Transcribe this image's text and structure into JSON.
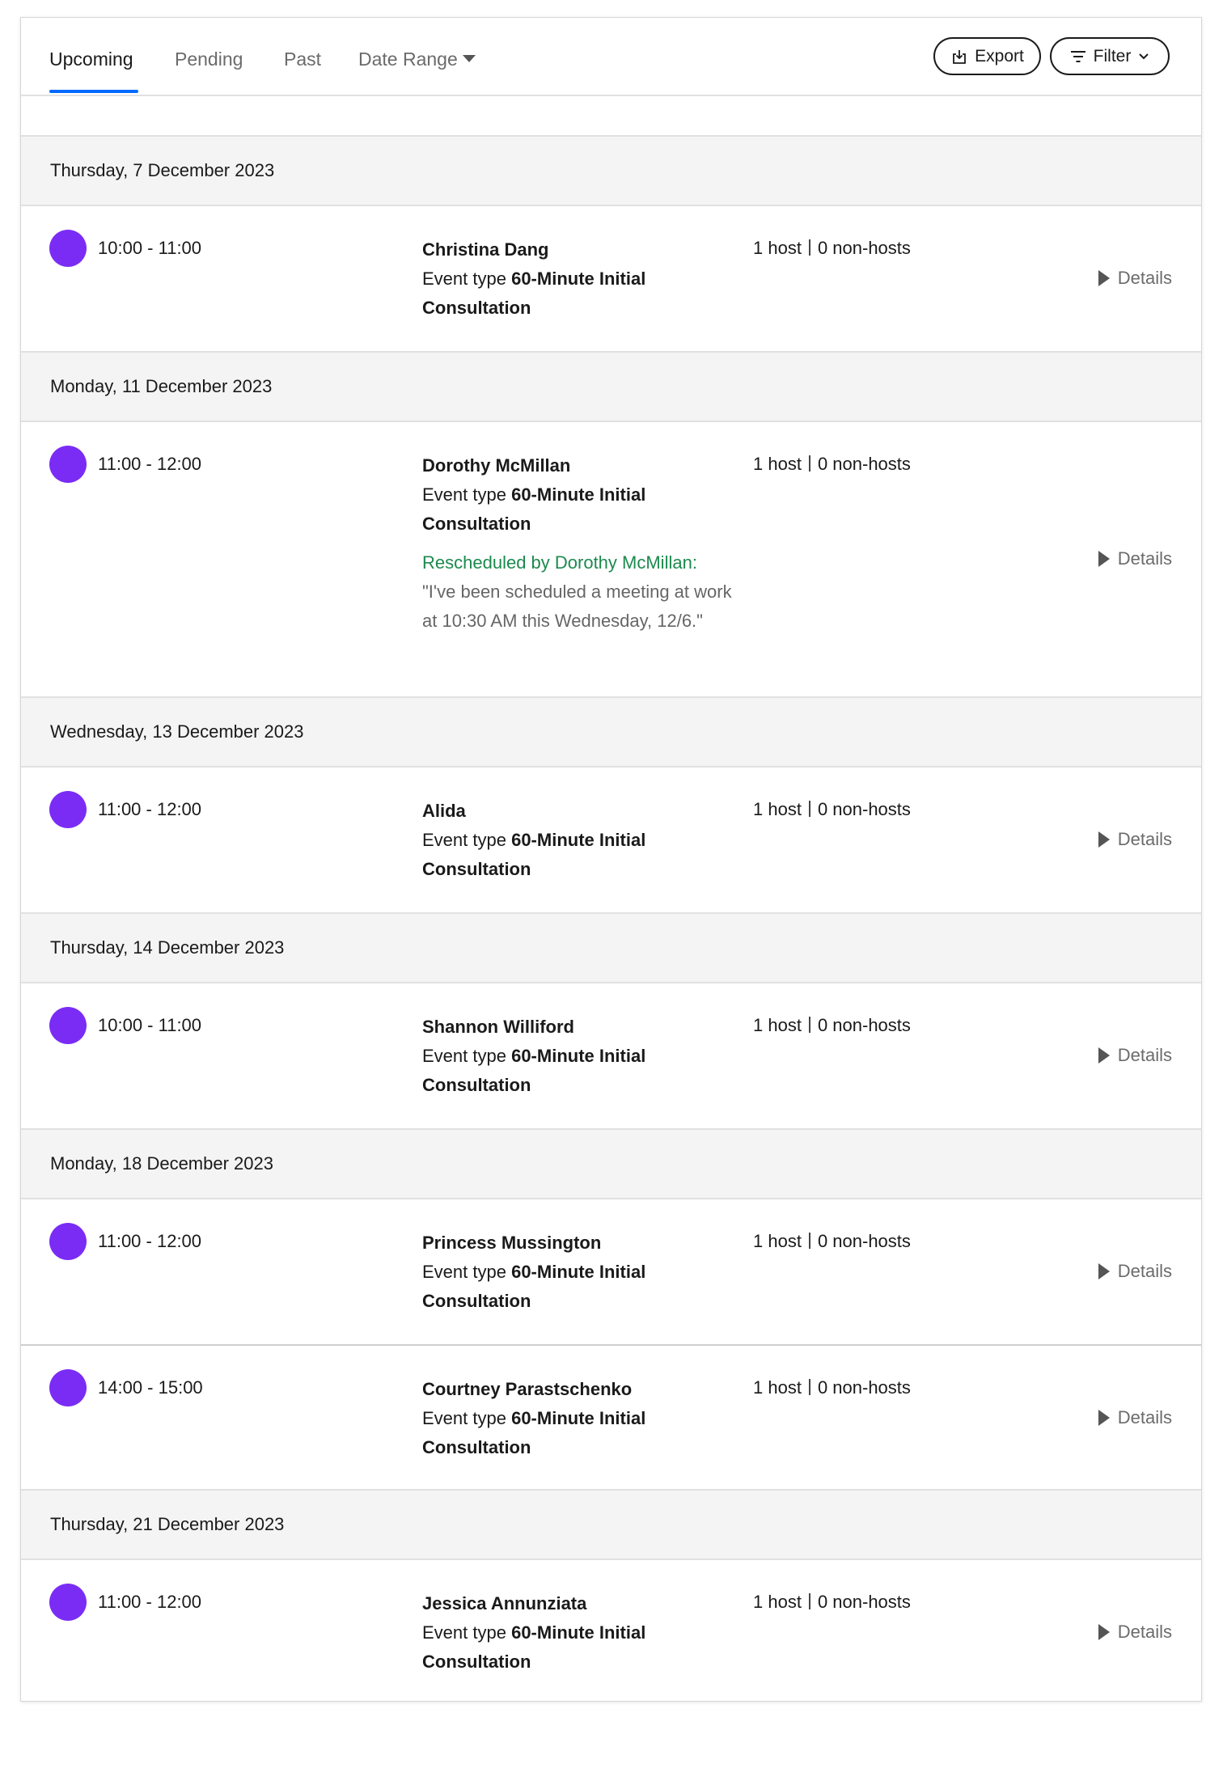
{
  "tabs": [
    {
      "label": "Upcoming",
      "active": true
    },
    {
      "label": "Pending",
      "active": false
    },
    {
      "label": "Past",
      "active": false
    },
    {
      "label": "Date Range",
      "active": false
    }
  ],
  "toolbar": {
    "export_label": "Export",
    "filter_label": "Filter"
  },
  "colors": {
    "accent": "#0069ff",
    "event_dot": "#7a2cf5",
    "rescheduled": "#1c8a4e"
  },
  "details_label": "Details",
  "event_type_label": "Event type",
  "days": [
    {
      "date": "Thursday, 7 December 2023",
      "events": [
        {
          "time": "10:00 - 11:00",
          "name": "Christina Dang",
          "event_type": "60-Minute Initial Consultation",
          "hosts": "1 host",
          "non_hosts": "0 non-hosts"
        }
      ]
    },
    {
      "date": "Monday, 11 December 2023",
      "events": [
        {
          "time": "11:00 - 12:00",
          "name": "Dorothy McMillan",
          "event_type": "60-Minute Initial Consultation",
          "hosts": "1 host",
          "non_hosts": "0 non-hosts",
          "rescheduled_by": "Rescheduled by Dorothy McMillan:",
          "rescheduled_note": "\"I've been scheduled a meeting at work at 10:30 AM this Wednesday, 12/6.\""
        }
      ]
    },
    {
      "date": "Wednesday, 13 December 2023",
      "events": [
        {
          "time": "11:00 - 12:00",
          "name": "Alida",
          "event_type": "60-Minute Initial Consultation",
          "hosts": "1 host",
          "non_hosts": "0 non-hosts"
        }
      ]
    },
    {
      "date": "Thursday, 14 December 2023",
      "events": [
        {
          "time": "10:00 - 11:00",
          "name": "Shannon Williford",
          "event_type": "60-Minute Initial Consultation",
          "hosts": "1 host",
          "non_hosts": "0 non-hosts"
        }
      ]
    },
    {
      "date": "Monday, 18 December 2023",
      "events": [
        {
          "time": "11:00 - 12:00",
          "name": "Princess Mussington",
          "event_type": "60-Minute Initial Consultation",
          "hosts": "1 host",
          "non_hosts": "0 non-hosts"
        },
        {
          "time": "14:00 - 15:00",
          "name": "Courtney Parastschenko",
          "event_type": "60-Minute Initial Consultation",
          "hosts": "1 host",
          "non_hosts": "0 non-hosts"
        }
      ]
    },
    {
      "date": "Thursday, 21 December 2023",
      "events": [
        {
          "time": "11:00 - 12:00",
          "name": "Jessica Annunziata",
          "event_type": "60-Minute Initial Consultation",
          "hosts": "1 host",
          "non_hosts": "0 non-hosts"
        }
      ]
    }
  ]
}
